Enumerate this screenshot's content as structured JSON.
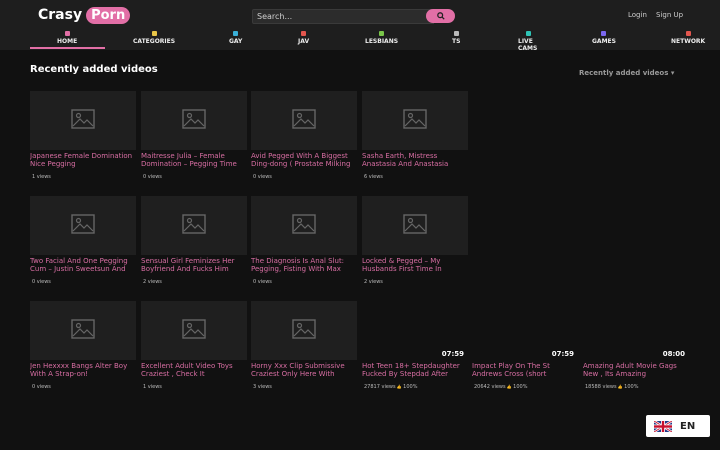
{
  "header": {
    "logo_word": "Crasy",
    "logo_pill": "Porn",
    "search_placeholder": "Search...",
    "login": "Login",
    "signup": "Sign Up"
  },
  "nav": [
    {
      "label": "HOME",
      "icon": "home-icon",
      "color": "#e26fa6"
    },
    {
      "label": "CATEGORIES",
      "icon": "folder-icon",
      "color": "#e8c547"
    },
    {
      "label": "GAY",
      "icon": "gay-icon",
      "color": "#3ab0d8"
    },
    {
      "label": "JAV",
      "icon": "jav-icon",
      "color": "#e2564e"
    },
    {
      "label": "LESBIANS",
      "icon": "lesbians-icon",
      "color": "#7ac64a"
    },
    {
      "label": "TS",
      "icon": "ts-icon",
      "color": "#bbbbbb"
    },
    {
      "label": "LIVE CAMS",
      "icon": "camera-icon",
      "color": "#2ec4b6"
    },
    {
      "label": "GAMES",
      "icon": "gamepad-icon",
      "color": "#7b68ee"
    },
    {
      "label": "NETWORK",
      "icon": "network-icon",
      "color": "#e2564e"
    }
  ],
  "main": {
    "section_title": "Recently added videos",
    "sort_label": "Recently added videos ▾"
  },
  "videos": [
    {
      "title": "Japanese Female Domination Nice Pegging",
      "views": "1 views"
    },
    {
      "title": "Maitresse Julia – Female Domination – Pegging Time",
      "views": "0 views"
    },
    {
      "title": "Avid Pegged With A Biggest Ding-dong ( Prostate Milking",
      "views": "0 views"
    },
    {
      "title": "Sasha Earth, Mistress Anastasia And Anastasia",
      "views": "6 views"
    },
    {
      "title": "Two Facial And One Pegging Cum – Justin Sweetsun And",
      "views": "0 views"
    },
    {
      "title": "Sensual Girl Feminizes Her Boyfriend And Fucks Him",
      "views": "2 views"
    },
    {
      "title": "The Diagnosis Is Anal Slut: Pegging, Fisting With Max",
      "views": "0 views"
    },
    {
      "title": "Locked & Pegged – My Husbands First Time In",
      "views": "2 views"
    },
    {
      "title": "Jen Hexxxx Bangs Alter Boy With A Strap-on!",
      "views": "0 views"
    },
    {
      "title": "Excellent Adult Video Toys Craziest , Check It",
      "views": "1 views"
    },
    {
      "title": "Horny Xxx Clip Submissive Craziest Only Here With",
      "views": "3 views"
    },
    {
      "title": "Hot Teen 18+ Stepdaughter Fucked By Stepdad After",
      "views": "27817 views",
      "rating": "100%",
      "duration": "07:59"
    },
    {
      "title": "Impact Play On The St Andrews Cross (short",
      "views": "20642 views",
      "rating": "100%",
      "duration": "07:59"
    },
    {
      "title": "Amazing Adult Movie Gags New , Its Amazing",
      "views": "18588 views",
      "rating": "100%",
      "duration": "08:00"
    }
  ],
  "language": {
    "code": "EN",
    "flag_icon": "uk-flag-icon"
  }
}
